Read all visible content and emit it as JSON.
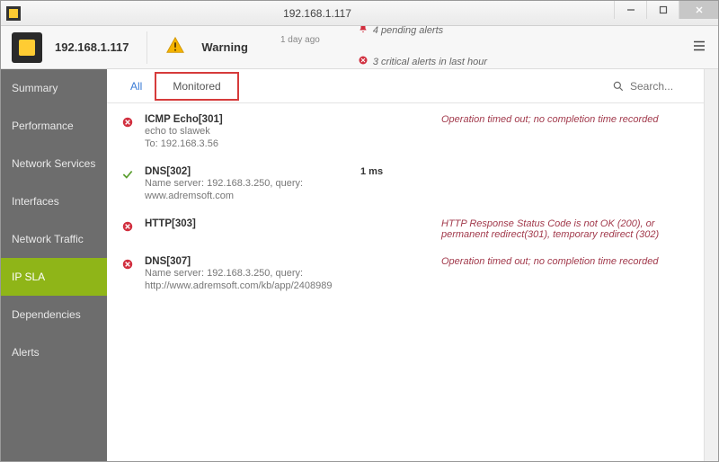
{
  "window": {
    "title": "192.168.1.117"
  },
  "header": {
    "device_ip": "192.168.1.117",
    "status_label": "Warning",
    "time_ago": "1 day ago",
    "pending_alerts": "4 pending alerts",
    "critical_alerts": "3 critical alerts in last hour"
  },
  "sidebar": {
    "items": [
      {
        "label": "Summary"
      },
      {
        "label": "Performance"
      },
      {
        "label": "Network Services"
      },
      {
        "label": "Interfaces"
      },
      {
        "label": "Network Traffic"
      },
      {
        "label": "IP SLA"
      },
      {
        "label": "Dependencies"
      },
      {
        "label": "Alerts"
      }
    ],
    "active_index": 5
  },
  "tabs": {
    "items": [
      {
        "label": "All"
      },
      {
        "label": "Monitored"
      }
    ],
    "selected_index": 1
  },
  "search": {
    "placeholder": "Search..."
  },
  "services": [
    {
      "status": "error",
      "name": "ICMP Echo[301]",
      "detail": "echo to slawek\nTo: 192.168.3.56",
      "metric": "",
      "message": "Operation timed out; no completion time recorded"
    },
    {
      "status": "ok",
      "name": "DNS[302]",
      "detail": "Name server: 192.168.3.250, query: www.adremsoft.com",
      "metric": "1 ms",
      "message": ""
    },
    {
      "status": "error",
      "name": "HTTP[303]",
      "detail": "",
      "metric": "",
      "message": "HTTP Response Status Code is not OK (200), or permanent redirect(301), temporary redirect (302)"
    },
    {
      "status": "error",
      "name": "DNS[307]",
      "detail": "Name server: 192.168.3.250, query: http://www.adremsoft.com/kb/app/2408989",
      "metric": "",
      "message": "Operation timed out; no completion time recorded"
    }
  ]
}
